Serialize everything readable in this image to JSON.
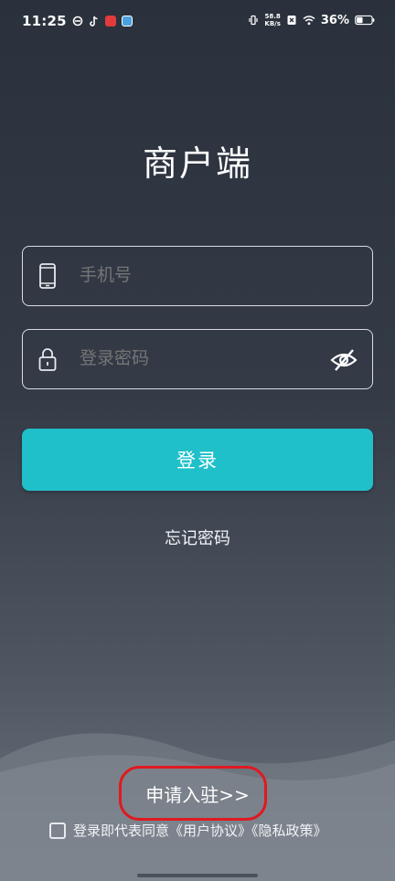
{
  "status_bar": {
    "time": "11:25",
    "speed_value": "58.8",
    "speed_unit": "KB/s",
    "battery": "36%"
  },
  "page": {
    "title": "商户端"
  },
  "form": {
    "phone_placeholder": "手机号",
    "password_placeholder": "登录密码",
    "login_label": "登录",
    "forgot_label": "忘记密码"
  },
  "footer": {
    "apply_label": "申请入驻>>",
    "agreement_text": "登录即代表同意《用户协议》《隐私政策》"
  },
  "colors": {
    "accent": "#1fc0ca",
    "highlight_ring": "#e0191f"
  }
}
